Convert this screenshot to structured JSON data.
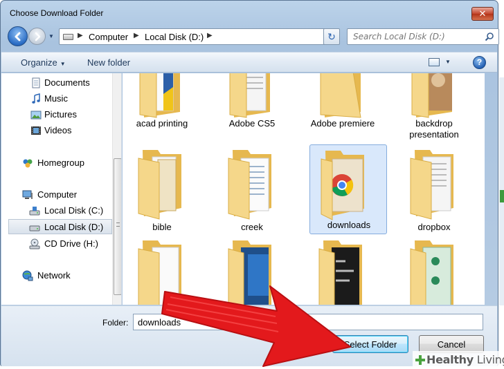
{
  "window": {
    "title": "Choose Download Folder",
    "close_glyph": "✕"
  },
  "address": {
    "crumbs": [
      "Computer",
      "Local Disk (D:)"
    ],
    "separator": "▶",
    "dropdown_glyph": "▼",
    "refresh_glyph": "↻"
  },
  "search": {
    "placeholder": "Search Local Disk (D:)"
  },
  "toolbar": {
    "organize": "Organize",
    "organize_caret": "▼",
    "new_folder": "New folder",
    "views_caret": "▼",
    "help": "?"
  },
  "nav": {
    "items": [
      {
        "label": "Documents",
        "icon": "documents-icon"
      },
      {
        "label": "Music",
        "icon": "music-icon"
      },
      {
        "label": "Pictures",
        "icon": "pictures-icon"
      },
      {
        "label": "Videos",
        "icon": "videos-icon"
      },
      {
        "label": "Homegroup",
        "icon": "homegroup-icon"
      },
      {
        "label": "Computer",
        "icon": "computer-icon"
      },
      {
        "label": "Local Disk (C:)",
        "icon": "drive-icon"
      },
      {
        "label": "Local Disk (D:)",
        "icon": "drive-icon",
        "selected": true
      },
      {
        "label": "CD Drive (H:)",
        "icon": "cd-drive-icon"
      },
      {
        "label": "Network",
        "icon": "network-icon"
      }
    ]
  },
  "folders": [
    {
      "name": "acad printing"
    },
    {
      "name": "Adobe CS5"
    },
    {
      "name": "Adobe premiere"
    },
    {
      "name": "backdrop presentation"
    },
    {
      "name": "bible"
    },
    {
      "name": "creek"
    },
    {
      "name": "downloads",
      "selected": true
    },
    {
      "name": "dropbox"
    },
    {
      "name": ""
    },
    {
      "name": ""
    },
    {
      "name": ""
    },
    {
      "name": ""
    }
  ],
  "folder_field": {
    "label": "Folder:",
    "value": "downloads"
  },
  "buttons": {
    "select": "Select Folder",
    "cancel": "Cancel"
  },
  "watermark": {
    "bold": "Healthy",
    "light": " Living"
  },
  "colors": {
    "arrow": "#e3191c",
    "folder": "#f3d27f",
    "selection": "#d9e8fb",
    "accent": "#2a6cc4"
  }
}
